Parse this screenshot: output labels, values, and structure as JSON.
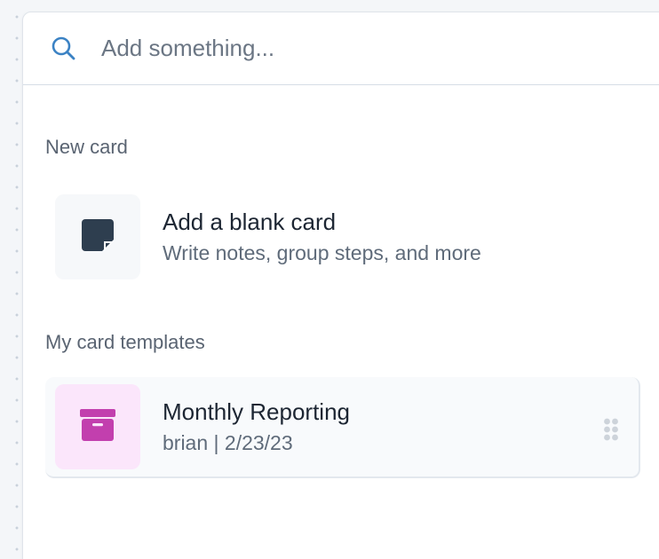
{
  "search": {
    "placeholder": "Add something..."
  },
  "sections": {
    "new_card": "New card",
    "my_templates": "My card templates"
  },
  "blank_card": {
    "title": "Add a blank card",
    "subtitle": "Write notes, group steps, and more",
    "icon": "sticky-note-icon"
  },
  "templates": [
    {
      "title": "Monthly Reporting",
      "meta": "brian | 2/23/23",
      "icon": "archive-box-icon"
    }
  ],
  "colors": {
    "accent": "#3b82c4",
    "note_icon": "#2e3e4f",
    "archive_icon": "#c23fae",
    "archive_tile_bg": "#fbe6fb"
  }
}
